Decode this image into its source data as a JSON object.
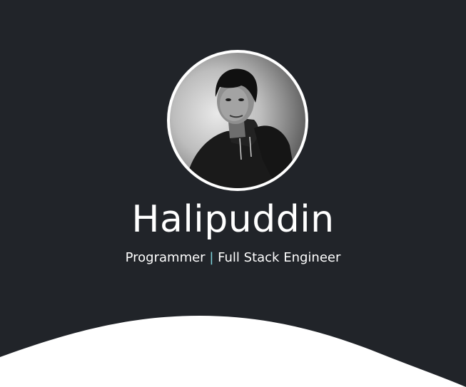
{
  "profile": {
    "name": "Halipuddin",
    "role_primary": "Programmer",
    "separator": "|",
    "role_secondary": "Full Stack Engineer"
  },
  "colors": {
    "background": "#212429",
    "text": "#ffffff",
    "accent": "#7fd3d9",
    "wave": "#ffffff"
  },
  "icons": {
    "avatar": "profile-photo"
  }
}
